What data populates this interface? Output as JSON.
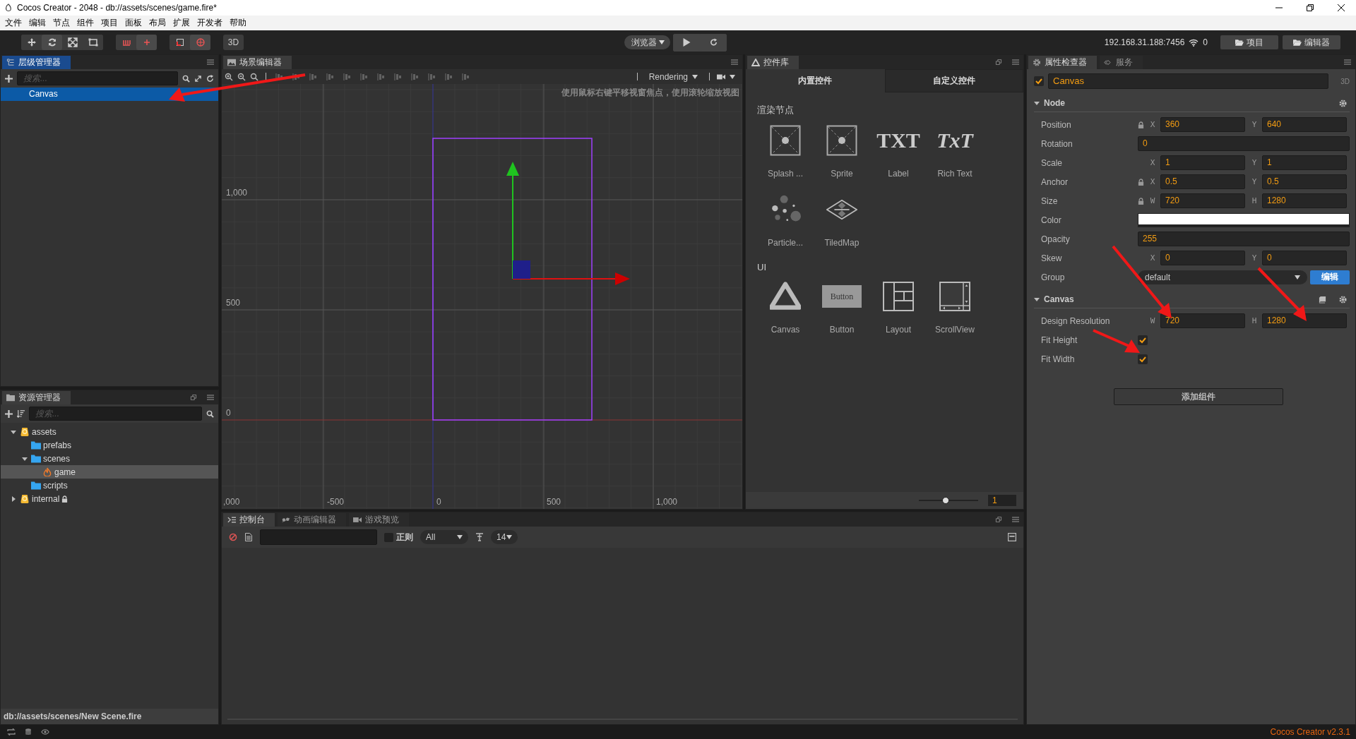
{
  "window": {
    "title": "Cocos Creator - 2048 - db://assets/scenes/game.fire*"
  },
  "menu": [
    "文件",
    "编辑",
    "节点",
    "组件",
    "项目",
    "面板",
    "布局",
    "扩展",
    "开发者",
    "帮助"
  ],
  "toolbar": {
    "mode_button": "3D",
    "preview_select": "浏览器",
    "ip": "192.168.31.188:7456",
    "connections": "0",
    "buttons": [
      "项目",
      "编辑器"
    ]
  },
  "hierarchy": {
    "tab": "层级管理器",
    "search": {
      "placeholder": "搜索..."
    },
    "tree": [
      {
        "label": "Canvas",
        "selected": true
      }
    ]
  },
  "scene": {
    "tab": "场景编辑器",
    "render_select": "Rendering",
    "hint": "使用鼠标右键平移视窗焦点，使用滚轮缩放视图",
    "y_labels": [
      "1,000",
      "500",
      "0"
    ],
    "x_labels": [
      ",000",
      "-500",
      "0",
      "500",
      "1,000"
    ]
  },
  "widgets": {
    "tab": "控件库",
    "tabs": [
      {
        "label": "内置控件",
        "selected": true
      },
      {
        "label": "自定义控件",
        "selected": false
      }
    ],
    "sections": [
      {
        "title": "渲染节点",
        "items": [
          {
            "label": "Splash ...",
            "kind": "sprite"
          },
          {
            "label": "Sprite",
            "kind": "sprite"
          },
          {
            "label": "Label",
            "kind": "label",
            "icon_text": "TXT"
          },
          {
            "label": "Rich Text",
            "kind": "richtext",
            "icon_text": "TxT"
          },
          {
            "label": "Particle...",
            "kind": "particle"
          },
          {
            "label": "TiledMap",
            "kind": "tiledmap"
          }
        ]
      },
      {
        "title": "UI",
        "items": [
          {
            "label": "Canvas",
            "kind": "canvas"
          },
          {
            "label": "Button",
            "kind": "button",
            "icon_text": "Button"
          },
          {
            "label": "Layout",
            "kind": "layout"
          },
          {
            "label": "ScrollView",
            "kind": "scrollview"
          }
        ]
      }
    ],
    "zoom": {
      "level": 0.45,
      "value": "1"
    }
  },
  "inspector": {
    "tabs": [
      {
        "label": "属性检查器",
        "selected": true,
        "kind": "gear"
      },
      {
        "label": "服务",
        "selected": false,
        "kind": "service"
      }
    ],
    "node": {
      "active": true,
      "name": "Canvas",
      "mode": "3D"
    },
    "sections": [
      {
        "title": "Node",
        "expanded": true,
        "kind": "node",
        "props": [
          {
            "label": "Position",
            "kind": "pair",
            "locked": true,
            "fields": [
              {
                "axis": "X",
                "value": "360"
              },
              {
                "axis": "Y",
                "value": "640"
              }
            ]
          },
          {
            "label": "Rotation",
            "kind": "single",
            "value": "0"
          },
          {
            "label": "Scale",
            "kind": "pair",
            "locked": false,
            "fields": [
              {
                "axis": "X",
                "value": "1"
              },
              {
                "axis": "Y",
                "value": "1"
              }
            ]
          },
          {
            "label": "Anchor",
            "kind": "pair",
            "locked": true,
            "fields": [
              {
                "axis": "X",
                "value": "0.5"
              },
              {
                "axis": "Y",
                "value": "0.5"
              }
            ]
          },
          {
            "label": "Size",
            "kind": "pair",
            "locked": true,
            "fields": [
              {
                "axis": "W",
                "value": "720"
              },
              {
                "axis": "H",
                "value": "1280"
              }
            ]
          },
          {
            "label": "Color",
            "kind": "color",
            "color": "#ffffff"
          },
          {
            "label": "Opacity",
            "kind": "single",
            "value": "255"
          },
          {
            "label": "Skew",
            "kind": "pair",
            "locked": false,
            "fields": [
              {
                "axis": "X",
                "value": "0"
              },
              {
                "axis": "Y",
                "value": "0"
              }
            ]
          },
          {
            "label": "Group",
            "kind": "select",
            "value": "default",
            "button": "编辑"
          }
        ]
      },
      {
        "title": "Canvas",
        "expanded": true,
        "kind": "component",
        "props": [
          {
            "label": "Design Resolution",
            "kind": "pair",
            "locked": false,
            "fields": [
              {
                "axis": "W",
                "value": "720"
              },
              {
                "axis": "H",
                "value": "1280"
              }
            ]
          },
          {
            "label": "Fit Height",
            "kind": "checkbox",
            "checked": true
          },
          {
            "label": "Fit Width",
            "kind": "checkbox",
            "checked": true
          }
        ]
      }
    ],
    "add_button": "添加组件"
  },
  "assets": {
    "tab": "资源管理器",
    "search": {
      "placeholder": "搜索..."
    },
    "tree": [
      {
        "label": "assets",
        "kind": "db",
        "expanded": true,
        "selected": false,
        "locked": false,
        "children": [
          {
            "label": "prefabs",
            "kind": "folder",
            "selected": false,
            "locked": false
          },
          {
            "label": "scenes",
            "kind": "folder",
            "expanded": true,
            "selected": false,
            "locked": false,
            "children": [
              {
                "label": "game",
                "kind": "fire",
                "selected": true,
                "locked": false
              }
            ]
          },
          {
            "label": "scripts",
            "kind": "folder",
            "selected": false,
            "locked": false
          }
        ]
      },
      {
        "label": "internal",
        "kind": "db",
        "expanded": false,
        "selected": false,
        "locked": true
      }
    ],
    "path": "db://assets/scenes/New Scene.fire"
  },
  "console": {
    "tabs": [
      {
        "label": "控制台",
        "selected": true,
        "kind": "console"
      },
      {
        "label": "动画编辑器",
        "selected": false,
        "kind": "animation"
      },
      {
        "label": "游戏预览",
        "selected": false,
        "kind": "preview"
      }
    ],
    "regex": {
      "label": "正则",
      "checked": false
    },
    "level_select": "All",
    "font_size": "14"
  },
  "status_bar": {
    "version": "Cocos Creator v2.3.1"
  }
}
